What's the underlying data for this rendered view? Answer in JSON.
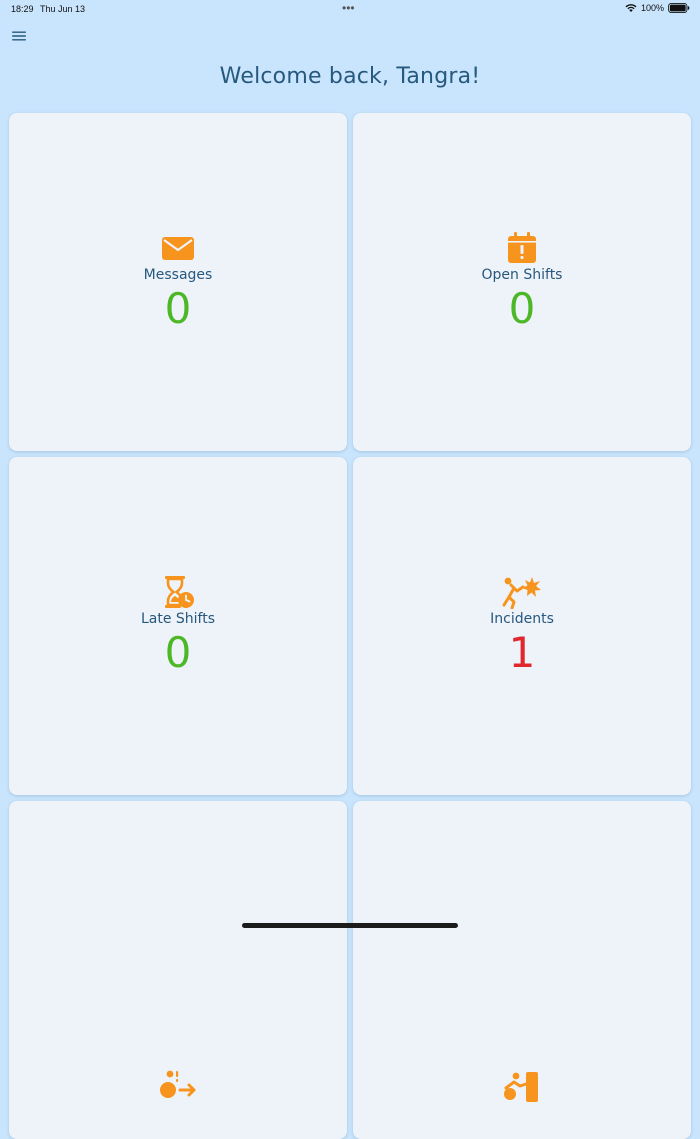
{
  "status_bar": {
    "time": "18:29",
    "date": "Thu Jun 13",
    "dots": "•••",
    "battery": "100%"
  },
  "header": {
    "menu_icon": "hamburger-menu-icon",
    "welcome": "Welcome back, Tangra!"
  },
  "colors": {
    "background": "#c9e5fd",
    "card": "#eef3f9",
    "accent_icon": "#f7941d",
    "text": "#27587e",
    "count_zero": "#4cb827",
    "count_alert": "#e0272d"
  },
  "tiles": [
    {
      "label": "Messages",
      "count": "0",
      "icon": "envelope-icon"
    },
    {
      "label": "Open Shifts",
      "count": "0",
      "icon": "calendar-alert-icon"
    },
    {
      "label": "Late Shifts",
      "count": "0",
      "icon": "hourglass-clock-icon"
    },
    {
      "label": "Incidents",
      "count": "1",
      "icon": "person-falling-icon"
    },
    {
      "label": "",
      "count": "",
      "icon": "person-clock-icon"
    },
    {
      "label": "",
      "count": "",
      "icon": "person-door-icon"
    }
  ]
}
